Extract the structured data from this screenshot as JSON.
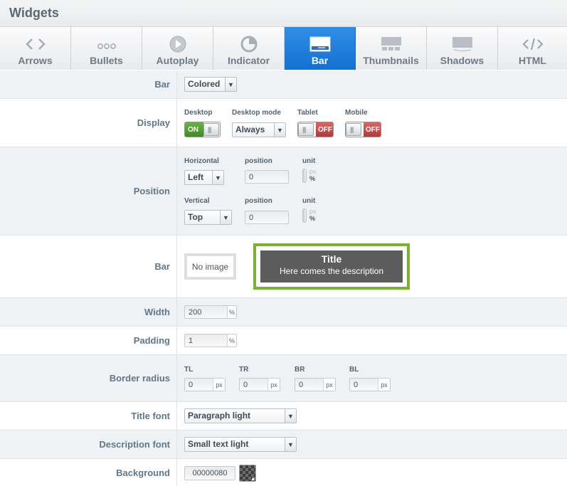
{
  "header": {
    "title": "Widgets"
  },
  "tabs": [
    {
      "label": "Arrows",
      "icon": "arrows-icon"
    },
    {
      "label": "Bullets",
      "icon": "bullets-icon"
    },
    {
      "label": "Autoplay",
      "icon": "autoplay-icon"
    },
    {
      "label": "Indicator",
      "icon": "indicator-icon"
    },
    {
      "label": "Bar",
      "icon": "bar-icon",
      "active": true
    },
    {
      "label": "Thumbnails",
      "icon": "thumbnails-icon"
    },
    {
      "label": "Shadows",
      "icon": "shadows-icon"
    },
    {
      "label": "HTML",
      "icon": "html-icon"
    }
  ],
  "rows": {
    "bar_select": {
      "label": "Bar",
      "value": "Colored"
    },
    "display": {
      "label": "Display",
      "desktop": {
        "label": "Desktop",
        "state": "ON"
      },
      "desktop_mode": {
        "label": "Desktop mode",
        "value": "Always"
      },
      "tablet": {
        "label": "Tablet",
        "state": "OFF"
      },
      "mobile": {
        "label": "Mobile",
        "state": "OFF"
      }
    },
    "position": {
      "label": "Position",
      "horizontal": {
        "label": "Horizontal",
        "value": "Left",
        "position_label": "position",
        "position": "0",
        "unit_label": "unit",
        "unit_px": "px",
        "unit_pct": "%"
      },
      "vertical": {
        "label": "Vertical",
        "value": "Top",
        "position_label": "position",
        "position": "0",
        "unit_label": "unit",
        "unit_px": "px",
        "unit_pct": "%"
      }
    },
    "bar_preview": {
      "label": "Bar",
      "no_image": "No image",
      "preview_title": "Title",
      "preview_desc": "Here comes the description"
    },
    "width": {
      "label": "Width",
      "value": "200",
      "unit": "%"
    },
    "padding": {
      "label": "Padding",
      "value": "1",
      "unit": "%"
    },
    "border_radius": {
      "label": "Border radius",
      "tl": {
        "label": "TL",
        "value": "0",
        "unit": "px"
      },
      "tr": {
        "label": "TR",
        "value": "0",
        "unit": "px"
      },
      "br": {
        "label": "BR",
        "value": "0",
        "unit": "px"
      },
      "bl": {
        "label": "BL",
        "value": "0",
        "unit": "px"
      }
    },
    "title_font": {
      "label": "Title font",
      "value": "Paragraph light"
    },
    "description_font": {
      "label": "Description font",
      "value": "Small text light"
    },
    "background": {
      "label": "Background",
      "value": "00000080"
    }
  },
  "colors": {
    "active_tab": "#1a78d8",
    "accent_green": "#79b52a",
    "on_green": "#4f9e2d",
    "off_red": "#c94444"
  }
}
